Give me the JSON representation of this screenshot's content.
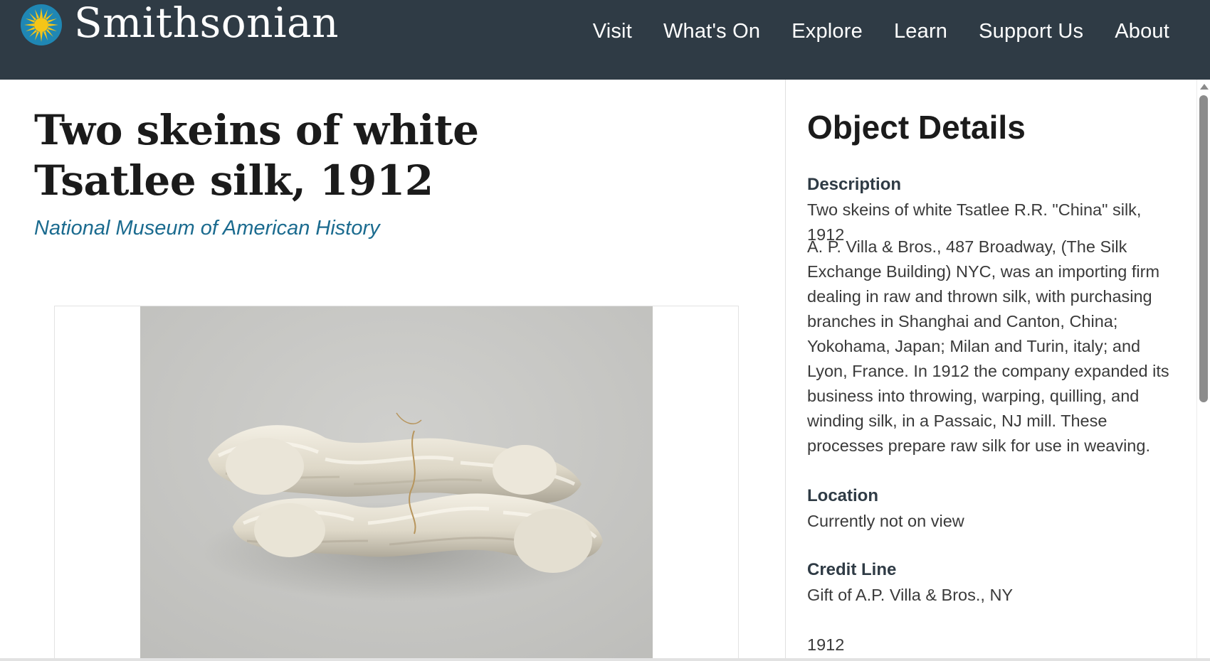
{
  "header": {
    "brand": "Smithsonian",
    "logo_icon": "smithsonian-sun-icon",
    "background": "#2f3b45",
    "nav": [
      "Visit",
      "What's On",
      "Explore",
      "Learn",
      "Support Us",
      "About"
    ]
  },
  "object": {
    "title": "Two skeins of white Tsatlee silk, 1912",
    "museum": "National Museum of American History",
    "image_subject": "two skeins of white silk"
  },
  "details": {
    "heading": "Object Details",
    "description_label": "Description",
    "description_short": "Two skeins of white Tsatlee R.R. \"China\" silk, 1912",
    "description_long": "A. P. Villa & Bros., 487 Broadway, (The Silk Exchange Building) NYC, was an importing firm dealing in raw and thrown silk, with purchasing branches in Shanghai and Canton, China; Yokohama, Japan; Milan and Turin, italy; and Lyon, France. In 1912 the company expanded its business into throwing, warping, quilling, and winding silk, in a Passaic, NJ mill. These processes prepare raw silk for use in weaving.",
    "location_label": "Location",
    "location_value": "Currently not on view",
    "credit_label": "Credit Line",
    "credit_value": "Gift of A.P. Villa & Bros., NY",
    "date_value": "1912"
  },
  "colors": {
    "header_bg": "#2f3b45",
    "link": "#1b6b8f",
    "logo_blue": "#1f87b4",
    "logo_yellow": "#f5c518"
  }
}
